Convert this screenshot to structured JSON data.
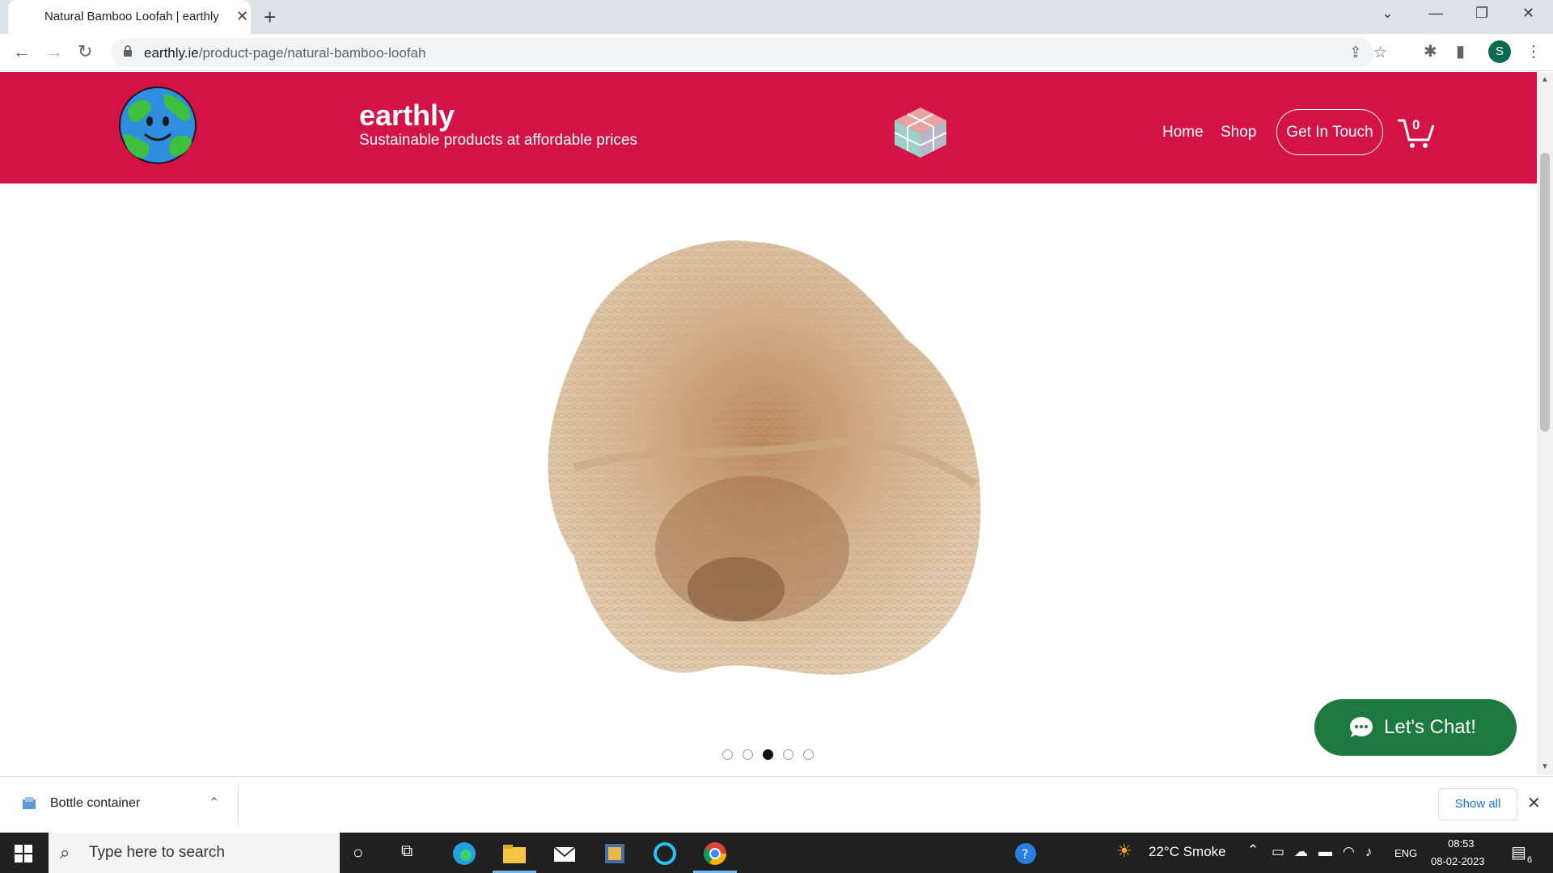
{
  "browser": {
    "tab_title": "Natural Bamboo Loofah | earthly",
    "tab_close": "✕",
    "new_tab": "+",
    "url_host": "earthly.ie",
    "url_path": "/product-page/natural-bamboo-loofah",
    "profile_initial": "S"
  },
  "site": {
    "brand": "earthly",
    "tagline": "Sustainable products at affordable prices",
    "nav": {
      "home": "Home",
      "shop": "Shop",
      "get_in_touch": "Get In Touch"
    },
    "cart_count": "0",
    "header_color": "#d31245"
  },
  "gallery": {
    "image_label": "Natural bamboo loofah",
    "slide_count": 5,
    "active_slide": 3
  },
  "chat": {
    "label": "Let's Chat!",
    "color": "#1d7a3e"
  },
  "downloads": {
    "file_name": "Bottle container",
    "show_all": "Show all"
  },
  "taskbar": {
    "search_placeholder": "Type here to search",
    "weather": "22°C  Smoke",
    "language": "ENG",
    "time": "08:53",
    "date": "08-02-2023",
    "notification_count": "6"
  }
}
